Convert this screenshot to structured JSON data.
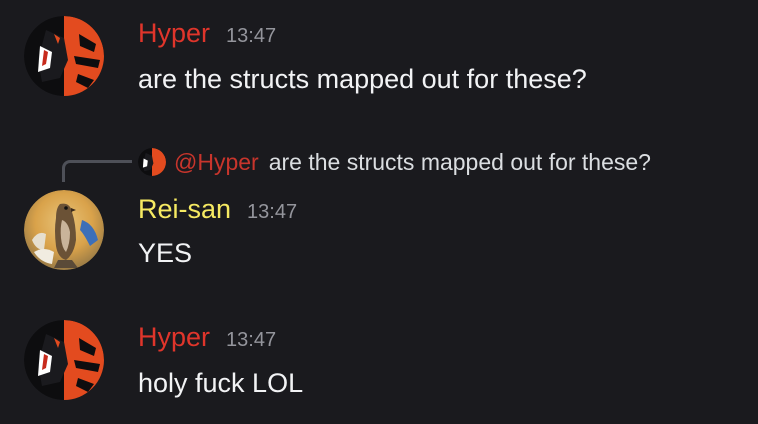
{
  "messages": [
    {
      "author": "Hyper",
      "time": "13:47",
      "text": "are the structs mapped out for these?",
      "avatar_icon": "hyper-avatar-icon"
    },
    {
      "reply": {
        "mention": "@Hyper",
        "text": "are the structs mapped out for these?"
      },
      "author": "Rei-san",
      "time": "13:47",
      "text": "YES",
      "avatar_icon": "hawk-avatar-icon"
    },
    {
      "author": "Hyper",
      "time": "13:47",
      "text": "holy fuck LOL",
      "avatar_icon": "hyper-avatar-icon"
    }
  ],
  "colors": {
    "background": "#1a1a1e",
    "hyper_name": "#e0352b",
    "rei_name": "#f6ea62",
    "timestamp": "#94959c",
    "message_text": "#f2f3f5"
  }
}
